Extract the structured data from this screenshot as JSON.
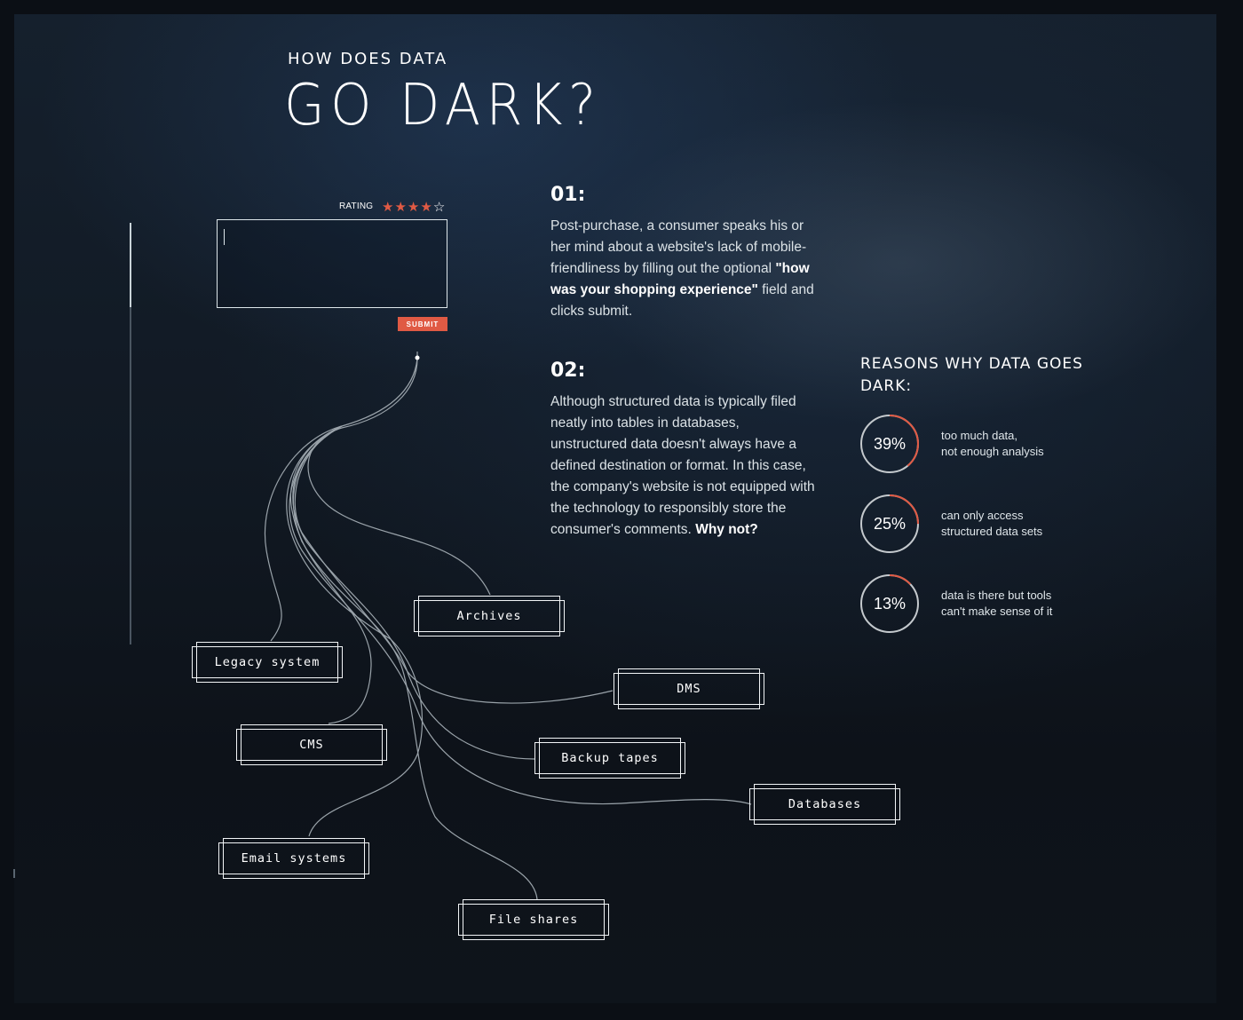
{
  "header": {
    "subtitle": "HOW DOES DATA",
    "title": "GO DARK?"
  },
  "form": {
    "rating_label": "RATING",
    "rating": {
      "value": 4,
      "max": 5,
      "filled_color": "#e05a44",
      "empty_color": "#ffffff"
    },
    "star_icons": [
      "star-filled-icon",
      "star-filled-icon",
      "star-filled-icon",
      "star-filled-icon",
      "star-empty-icon"
    ],
    "comment_value": "",
    "submit_label": "SUBMIT",
    "submit_color": "#e05a44"
  },
  "scroll": {
    "position_fraction": 0.0,
    "visible_fraction": 0.2
  },
  "steps": [
    {
      "number": "01:",
      "text_before": "Post-purchase, a consumer speaks his or her mind about a website's lack of mobile-friendliness by filling out the optional ",
      "text_bold": "\"how was your shopping experience\"",
      "text_after": " field and clicks submit."
    },
    {
      "number": "02:",
      "text_before": "Although structured data is typically filed neatly into tables in databases, unstructured data doesn't always have a defined destination or format. In this case, the company's website is not equipped with the technology to responsibly store the consumer's comments. ",
      "text_bold": "Why not?",
      "text_after": ""
    }
  ],
  "reasons": {
    "title": "REASONS WHY DATA GOES DARK:",
    "accent_color": "#e05a44",
    "items": [
      {
        "percent": 39,
        "label": "39%",
        "line1": "too much data,",
        "line2": "not enough analysis"
      },
      {
        "percent": 25,
        "label": "25%",
        "line1": "can only access",
        "line2": "structured data sets"
      },
      {
        "percent": 13,
        "label": "13%",
        "line1": "data is there but tools",
        "line2": "can't make sense of it"
      }
    ]
  },
  "diagram": {
    "nodes": [
      {
        "id": "archives",
        "label": "Archives"
      },
      {
        "id": "legacy",
        "label": "Legacy system"
      },
      {
        "id": "dms",
        "label": "DMS"
      },
      {
        "id": "cms",
        "label": "CMS"
      },
      {
        "id": "backup",
        "label": "Backup tapes"
      },
      {
        "id": "databases",
        "label": "Databases"
      },
      {
        "id": "email",
        "label": "Email systems"
      },
      {
        "id": "fileshares",
        "label": "File shares"
      }
    ],
    "edges": [
      {
        "from": "submit",
        "to": "archives"
      },
      {
        "from": "submit",
        "to": "legacy"
      },
      {
        "from": "submit",
        "to": "dms"
      },
      {
        "from": "submit",
        "to": "cms"
      },
      {
        "from": "submit",
        "to": "backup"
      },
      {
        "from": "submit",
        "to": "databases"
      },
      {
        "from": "submit",
        "to": "email"
      },
      {
        "from": "submit",
        "to": "fileshares"
      }
    ]
  }
}
